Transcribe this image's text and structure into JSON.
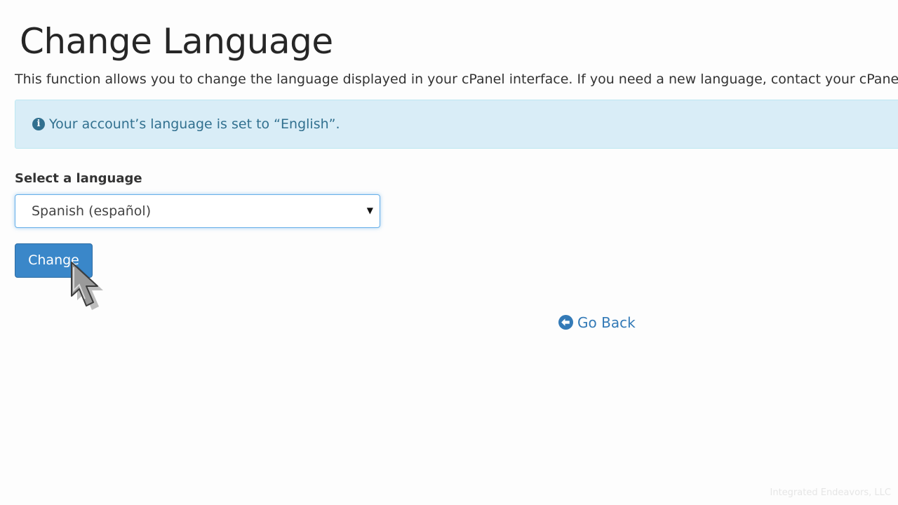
{
  "page": {
    "title": "Change Language",
    "description": "This function allows you to change the language displayed in your cPanel interface. If you need a new language, contact your cPanel"
  },
  "alert": {
    "icon": "info-circle-icon",
    "text": "Your account’s language is set to “English”."
  },
  "form": {
    "select_label": "Select a language",
    "selected_language": "Spanish (español)",
    "submit_label": "Change"
  },
  "nav": {
    "go_back_icon": "arrow-left-circle-icon",
    "go_back_label": "Go Back"
  },
  "footer": {
    "watermark": "Integrated Endeavors, LLC"
  },
  "colors": {
    "accent": "#3a87c9",
    "link": "#337ab7",
    "alert_bg": "#d9edf7",
    "alert_text": "#31708f",
    "focus_border": "#66afe9"
  }
}
